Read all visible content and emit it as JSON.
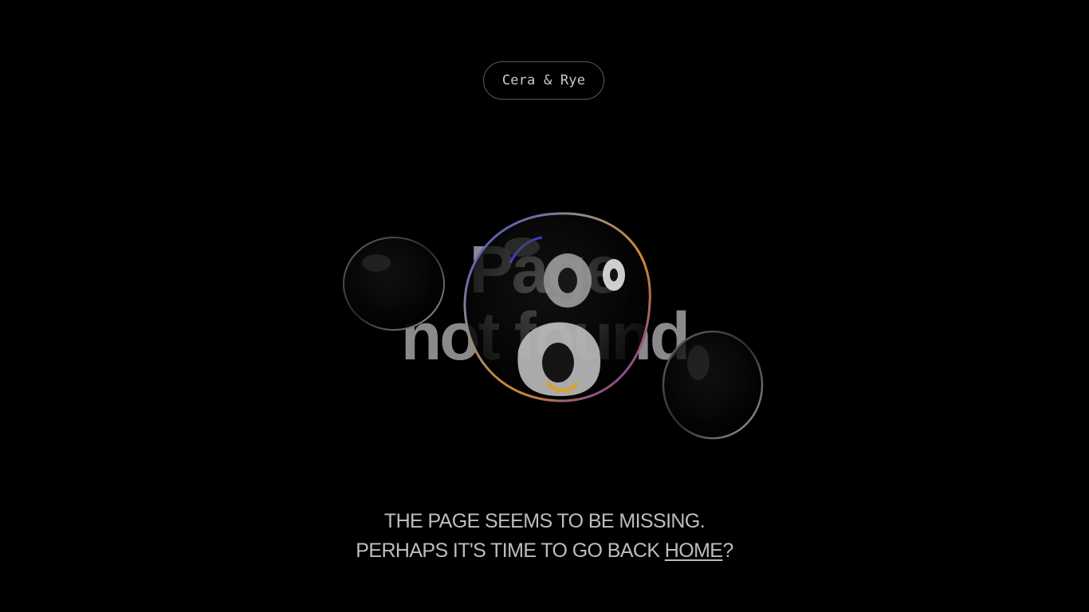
{
  "header": {
    "logo_text": "Cera & Rye"
  },
  "hero": {
    "headline_line1": "Page",
    "headline_line2": "not found"
  },
  "message": {
    "line1": "THE PAGE SEEMS TO BE MISSING.",
    "line2_prefix": "PERHAPS IT'S TIME TO GO BACK ",
    "home_link": "HOME",
    "line2_suffix": "?"
  },
  "colors": {
    "background": "#000000",
    "text": "#bdbdbd",
    "headline": "#8a8a8c"
  }
}
